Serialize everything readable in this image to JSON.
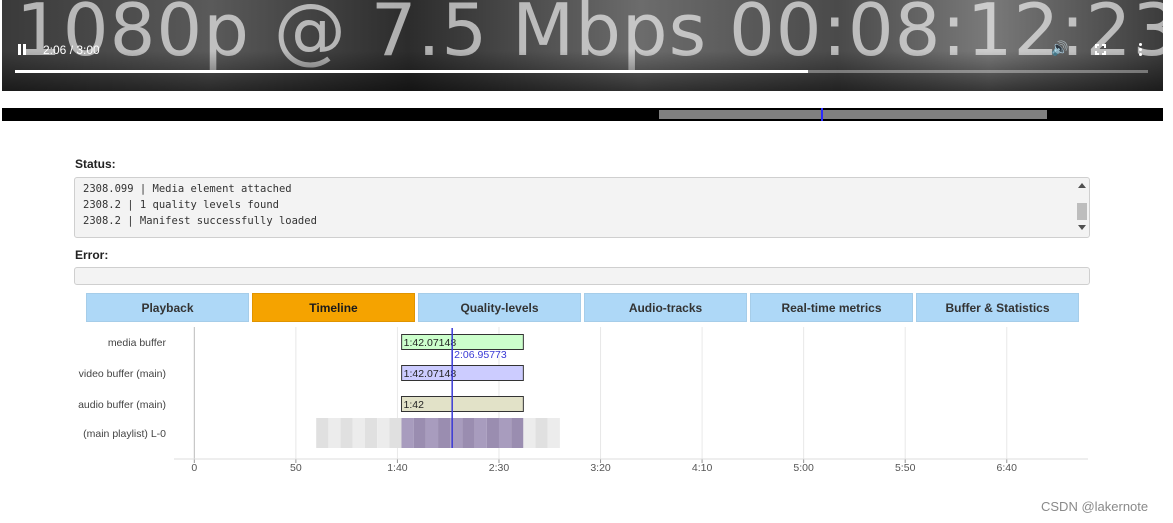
{
  "player": {
    "overlay_quality": "1080p @ 7.5 Mbps",
    "overlay_timecode": "00:08:12:23",
    "time_display": "2:06 / 3:00",
    "progress_fraction": 0.7,
    "icons": {
      "play_pause": "pause-icon",
      "volume": "volume-icon",
      "fullscreen": "fullscreen-icon",
      "more": "more-options-icon"
    }
  },
  "buffer_bar": {
    "range_start_fraction": 0.566,
    "range_end_fraction": 0.9,
    "cursor_fraction": 0.705
  },
  "status": {
    "label": "Status:",
    "log": [
      "2308.099 | Media element attached",
      "2308.2 | 1 quality levels found",
      "2308.2 | Manifest successfully loaded"
    ]
  },
  "error": {
    "label": "Error:",
    "value": ""
  },
  "tabs": [
    {
      "label": "Playback",
      "active": false
    },
    {
      "label": "Timeline",
      "active": true
    },
    {
      "label": "Quality-levels",
      "active": false
    },
    {
      "label": "Audio-tracks",
      "active": false
    },
    {
      "label": "Real-time metrics",
      "active": false
    },
    {
      "label": "Buffer & Statistics",
      "active": false
    }
  ],
  "colors": {
    "tab_bg": "#aed8f7",
    "tab_active": "#f5a300",
    "cursor": "#3a3ad6"
  },
  "timeline": {
    "axis_ticks": [
      {
        "value": 0,
        "label": "0"
      },
      {
        "value": 50,
        "label": "50"
      },
      {
        "value": 100,
        "label": "1:40"
      },
      {
        "value": 150,
        "label": "2:30"
      },
      {
        "value": 200,
        "label": "3:20"
      },
      {
        "value": 250,
        "label": "4:10"
      },
      {
        "value": 300,
        "label": "5:00"
      },
      {
        "value": 350,
        "label": "5:50"
      },
      {
        "value": 400,
        "label": "6:40"
      }
    ],
    "x_range": [
      -10,
      440
    ],
    "current_time": 126.96,
    "current_time_label": "2:06.95773",
    "rows": [
      {
        "label": "media buffer",
        "start": 102.07,
        "end": 162,
        "bar_label": "1:42.07148",
        "fill": "#ccffcc",
        "stroke": "#333333"
      },
      {
        "label": "video buffer (main)",
        "start": 102.07,
        "end": 162,
        "bar_label": "1:42.07148",
        "fill": "#ccccff",
        "stroke": "#333333"
      },
      {
        "label": "audio buffer (main)",
        "start": 102,
        "end": 162,
        "bar_label": "1:42",
        "fill": "#e2e2c8",
        "stroke": "#333333"
      },
      {
        "label": "(main playlist) L-0",
        "start": null,
        "end": null,
        "bar_label": "",
        "fill": "",
        "stroke": ""
      }
    ],
    "playlist_segments": [
      {
        "start": 60,
        "end": 66,
        "loaded": false
      },
      {
        "start": 66,
        "end": 72,
        "loaded": false
      },
      {
        "start": 72,
        "end": 78,
        "loaded": false
      },
      {
        "start": 78,
        "end": 84,
        "loaded": false
      },
      {
        "start": 84,
        "end": 90,
        "loaded": false
      },
      {
        "start": 90,
        "end": 96,
        "loaded": false
      },
      {
        "start": 96,
        "end": 102,
        "loaded": false
      },
      {
        "start": 102,
        "end": 108,
        "loaded": true
      },
      {
        "start": 108,
        "end": 114,
        "loaded": true
      },
      {
        "start": 114,
        "end": 120,
        "loaded": true
      },
      {
        "start": 120,
        "end": 126,
        "loaded": true
      },
      {
        "start": 126,
        "end": 132,
        "loaded": true
      },
      {
        "start": 132,
        "end": 138,
        "loaded": true
      },
      {
        "start": 138,
        "end": 144,
        "loaded": true
      },
      {
        "start": 144,
        "end": 150,
        "loaded": true
      },
      {
        "start": 150,
        "end": 156,
        "loaded": true
      },
      {
        "start": 156,
        "end": 162,
        "loaded": true
      },
      {
        "start": 162,
        "end": 168,
        "loaded": false
      },
      {
        "start": 168,
        "end": 174,
        "loaded": false
      },
      {
        "start": 174,
        "end": 180,
        "loaded": false
      }
    ]
  },
  "watermark": "CSDN @lakernote"
}
